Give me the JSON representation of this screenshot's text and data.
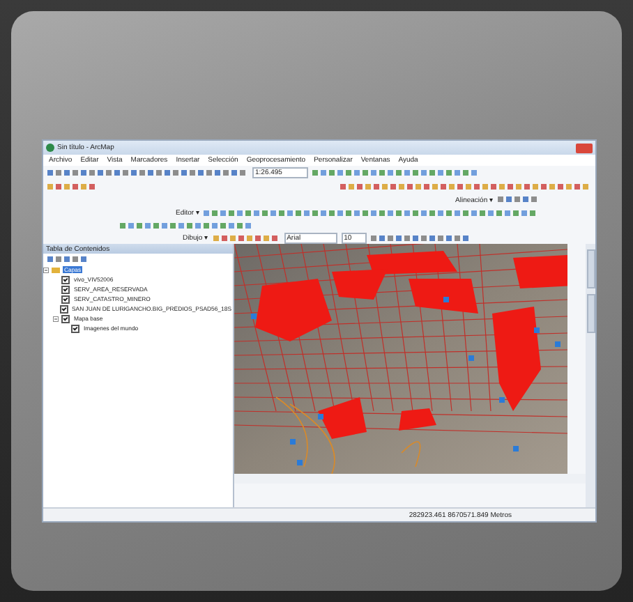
{
  "window": {
    "title": "Sin título - ArcMap"
  },
  "menu": [
    "Archivo",
    "Editar",
    "Vista",
    "Marcadores",
    "Insertar",
    "Selección",
    "Geoprocesamiento",
    "Personalizar",
    "Ventanas",
    "Ayuda"
  ],
  "toolbars": {
    "scale": "1:26.495",
    "editor": "Editor ▾",
    "alignment": "Alineación ▾",
    "drawing": "Dibujo ▾",
    "font": "Arial",
    "font_size": "10"
  },
  "toc": {
    "title": "Tabla de Contenidos",
    "layers": [
      {
        "name": "Capas",
        "selected": true,
        "expanded": true,
        "children": [
          {
            "name": "vivo_VIV52006",
            "checked": true
          },
          {
            "name": "SERV_AREA_RESERVADA",
            "checked": true
          },
          {
            "name": "SERV_CATASTRO_MINERO",
            "checked": true
          },
          {
            "name": "SAN JUAN DE LURIGANCHO.BIG_PREDIOS_PSAD56_18S",
            "checked": true
          },
          {
            "name": "Mapa base",
            "checked": true,
            "expanded": true,
            "children": [
              {
                "name": "Imagenes del mundo",
                "checked": true
              }
            ]
          }
        ]
      }
    ]
  },
  "status_bar": {
    "coordinates": "282923.461  8670571.849 Metros"
  }
}
